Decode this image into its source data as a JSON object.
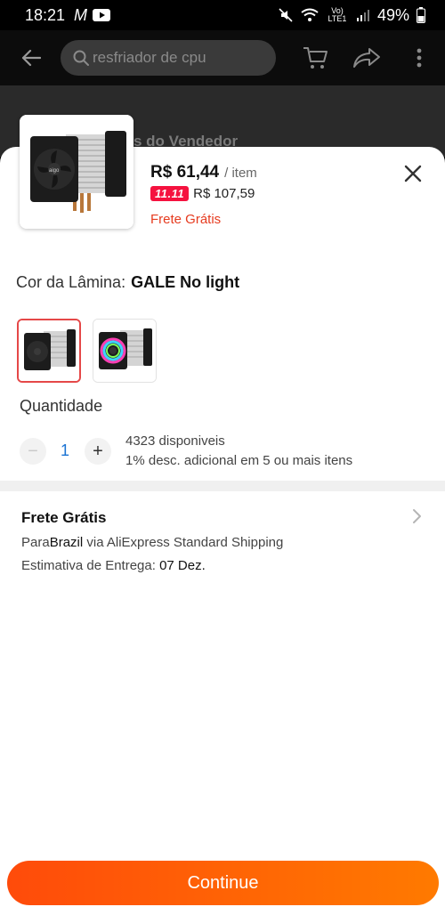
{
  "status_bar": {
    "time": "18:21",
    "carrier_icon": "M",
    "battery": "49%",
    "network": "Vo) LTE1"
  },
  "top_bar": {
    "search_placeholder": "resfriador de cpu"
  },
  "background": {
    "seller_text": "s do Vendedor"
  },
  "product": {
    "price": "R$ 61,44",
    "unit": "/ item",
    "promo_badge": "11.11",
    "original_price": "R$ 107,59",
    "shipping_tag": "Frete Grátis"
  },
  "color_option": {
    "label": "Cor da Lâmina:",
    "selected": "GALE No light"
  },
  "quantity": {
    "label": "Quantidade",
    "value": "1",
    "minus": "−",
    "plus": "+",
    "stock": "4323 disponiveis",
    "bulk_discount": "1% desc. adicional em 5 ou mais itens"
  },
  "shipping": {
    "title": "Frete Grátis",
    "to_prefix": "Para",
    "country": "Brazil",
    "method": " via AliExpress Standard Shipping",
    "estimate_label": "Estimativa de Entrega: ",
    "estimate_date": "07 Dez."
  },
  "continue_button": {
    "label": "Continue"
  },
  "colors": {
    "accent_red": "#e63b1f",
    "promo_badge": "#f5123f",
    "button_gradient_start": "#ff4b0a",
    "button_gradient_end": "#ff7a00",
    "selected_border": "#e54848",
    "quantity_blue": "#1b73d3"
  },
  "icons": {
    "back": "arrow-left-icon",
    "search": "search-icon",
    "cart": "cart-icon",
    "share": "share-icon",
    "more": "more-vertical-icon",
    "close": "close-icon",
    "chevron": "chevron-right-icon"
  }
}
